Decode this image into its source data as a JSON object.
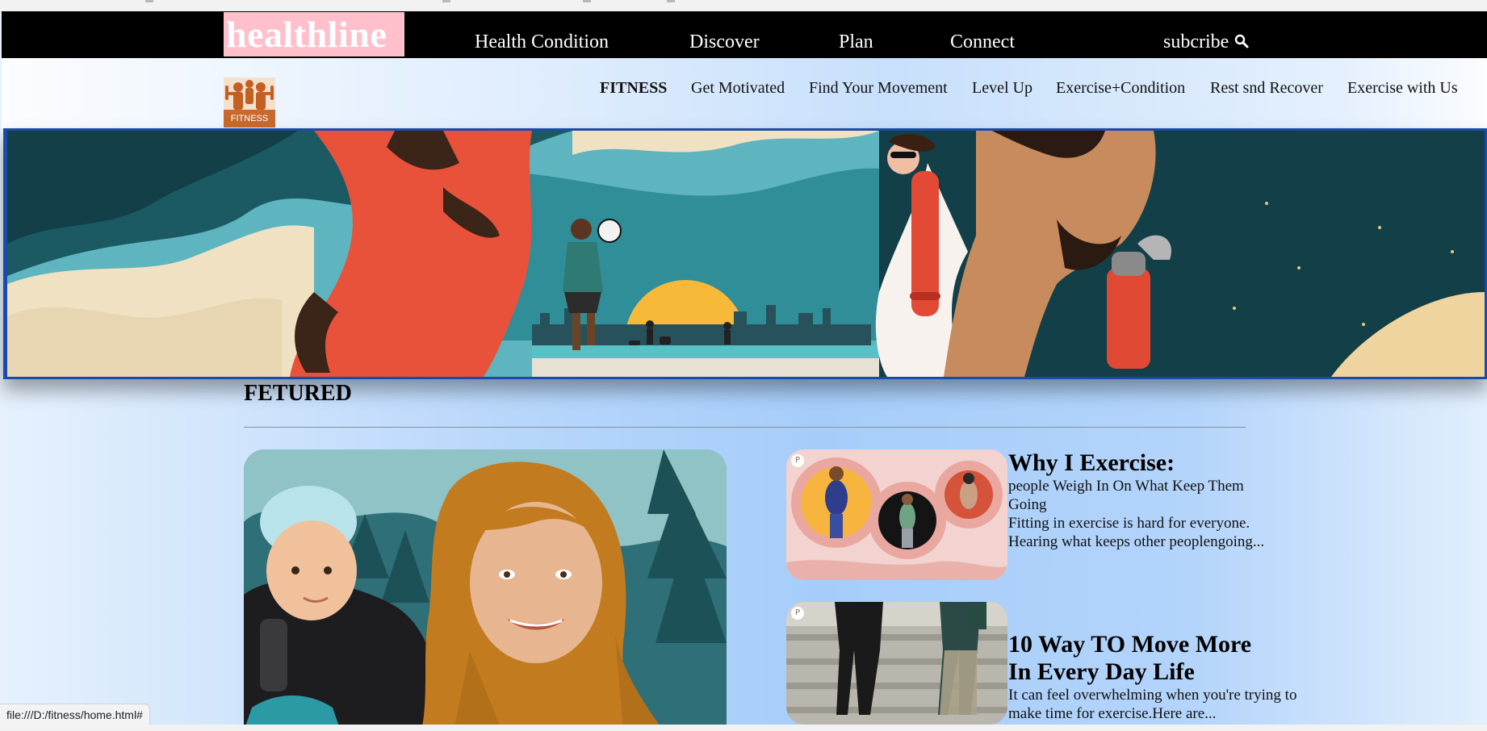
{
  "header": {
    "logo_text": "healthline",
    "nav": [
      "Health Condition",
      "Discover",
      "Plan",
      "Connect"
    ],
    "subscribe_label": "subcribe",
    "search_icon": "magnifier-icon"
  },
  "subnav": {
    "logo_text": "FITNESS",
    "items": [
      "FITNESS",
      "Get Motivated",
      "Find Your Movement",
      "Level Up",
      "Exercise+Condition",
      "Rest snd Recover",
      "Exercise with Us"
    ],
    "active_index": 0
  },
  "featured": {
    "heading": "FETURED",
    "cards": [
      {
        "title": "Why I Exercise:",
        "description": "people Weigh In On What Keep Them Going\nFitting in exercise is hard for everyone. Hearing what keeps other peoplengoing..."
      },
      {
        "title": "10 Way TO Move More In Every Day Life",
        "description": "It can feel overwhelming when you're trying to make time for exercise.Here are..."
      }
    ]
  },
  "status_bar": {
    "url": "file:///D:/fitness/home.html#"
  },
  "colors": {
    "navbar_bg": "#000000",
    "logo_bg": "#ffc0cb",
    "hero_border": "#1a4ba8",
    "page_gradient": "#b7d6fb"
  }
}
